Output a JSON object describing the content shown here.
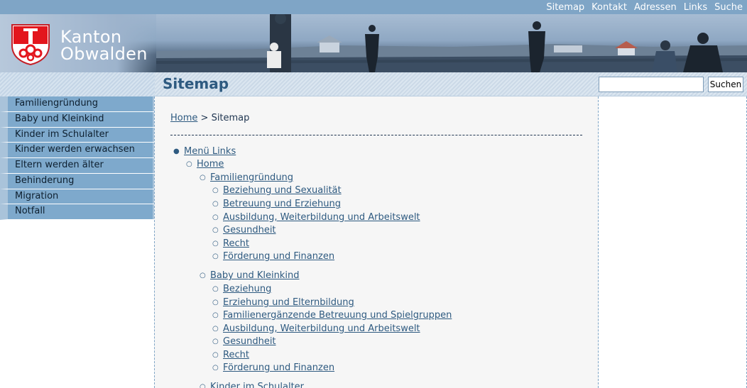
{
  "top_links": [
    "Sitemap",
    "Kontakt",
    "Adressen",
    "Links",
    "Suche"
  ],
  "logo": {
    "line1": "Kanton",
    "line2": "Obwalden"
  },
  "page_title": "Sitemap",
  "search": {
    "placeholder": "",
    "button": "Suchen"
  },
  "sidebar": {
    "items": [
      "Familiengründung",
      "Baby und Kleinkind",
      "Kinder im Schulalter",
      "Kinder werden erwachsen",
      "Eltern werden älter",
      "Behinderung",
      "Migration",
      "Notfall"
    ]
  },
  "breadcrumb": {
    "home": "Home",
    "separator": " > ",
    "current": "Sitemap"
  },
  "sitemap": {
    "root": "Menü Links",
    "home": "Home",
    "sections": [
      {
        "label": "Familiengründung",
        "children": [
          "Beziehung und Sexualität",
          "Betreuung und Erziehung",
          "Ausbildung, Weiterbildung und Arbeitswelt",
          "Gesundheit",
          "Recht",
          "Förderung und Finanzen"
        ]
      },
      {
        "label": "Baby und Kleinkind",
        "children": [
          "Beziehung",
          "Erziehung und Elternbildung",
          "Familienergänzende Betreuung und Spielgruppen",
          "Ausbildung, Weiterbildung und Arbeitswelt",
          "Gesundheit",
          "Recht",
          "Förderung und Finanzen"
        ]
      },
      {
        "label": "Kinder im Schulalter",
        "children": []
      }
    ]
  },
  "colors": {
    "topbar": "#7fa5c6",
    "nav": "#7ea9cc",
    "title": "#2e5a80",
    "link": "#2e5a80",
    "content_bg": "#f6f6f6"
  }
}
